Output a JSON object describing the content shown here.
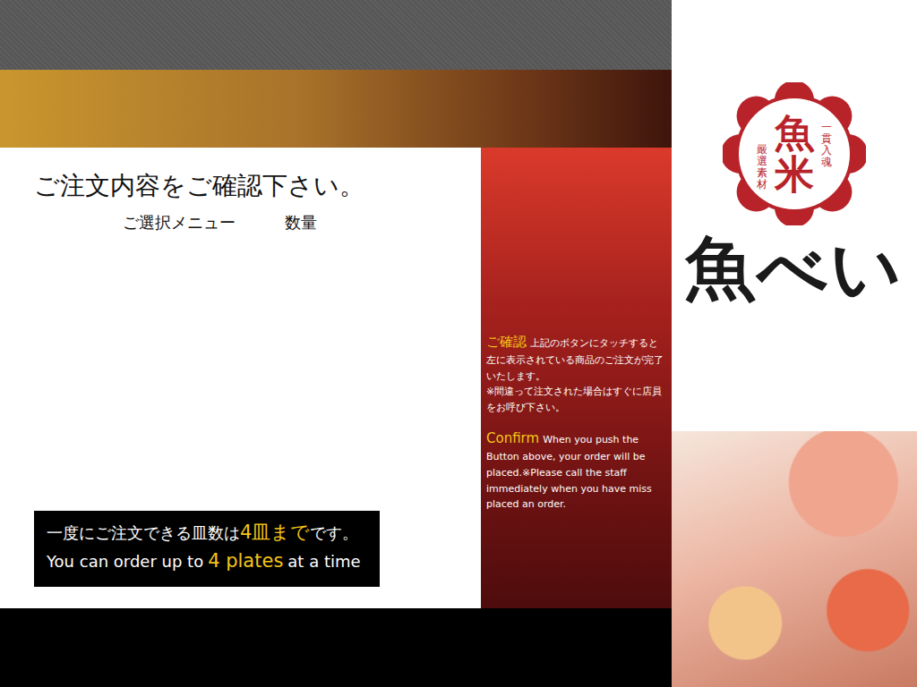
{
  "header": {
    "title": "ご注文内容をご確認下さい。",
    "columns": [
      "ご選択メニュー",
      "数量"
    ]
  },
  "notice": {
    "lines": [
      [
        {
          "text": "一度にご注文できる皿数は",
          "highlight": false
        },
        {
          "text": "4皿まで",
          "highlight": true
        },
        {
          "text": "です。",
          "highlight": false
        }
      ],
      [
        {
          "text": "You can order up to",
          "highlight": false
        },
        {
          "text": "4 plates",
          "highlight": true
        },
        {
          "text": "at a time",
          "highlight": false
        }
      ]
    ]
  },
  "confirm_panel": {
    "sections": [
      {
        "label": "ご確認",
        "lines": [
          "上記のボタンにタッチすると左に表示されている商品のご注文が完了いたします。",
          "※間違って注文された場合はすぐに店員をお呼び下さい。"
        ]
      },
      {
        "label": "Confirm",
        "lines": [
          "When you push the Button above, your order will be placed.※Please call the staff immediately when you have miss placed an order."
        ]
      }
    ]
  },
  "logo": {
    "main": "魚米",
    "left": "嚴選素材",
    "right": "一貫入魂"
  },
  "brand": "魚べい"
}
